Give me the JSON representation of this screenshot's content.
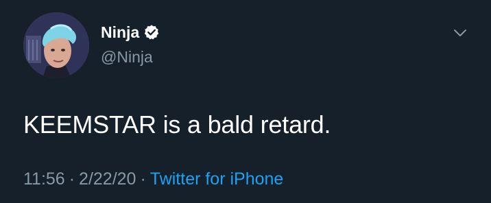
{
  "author": {
    "display_name": "Ninja",
    "handle": "@Ninja",
    "verified": true,
    "avatar": "profile-photo"
  },
  "tweet": {
    "text": "KEEMSTAR is a bald retard.",
    "time": "11:56",
    "separator": "·",
    "date": "2/22/20",
    "source": "Twitter for iPhone"
  },
  "icons": {
    "verified": "verified-badge-icon",
    "menu": "chevron-down-icon"
  },
  "colors": {
    "background": "#15202b",
    "text": "#ffffff",
    "secondary": "#8899a6",
    "link": "#1da1f2"
  }
}
